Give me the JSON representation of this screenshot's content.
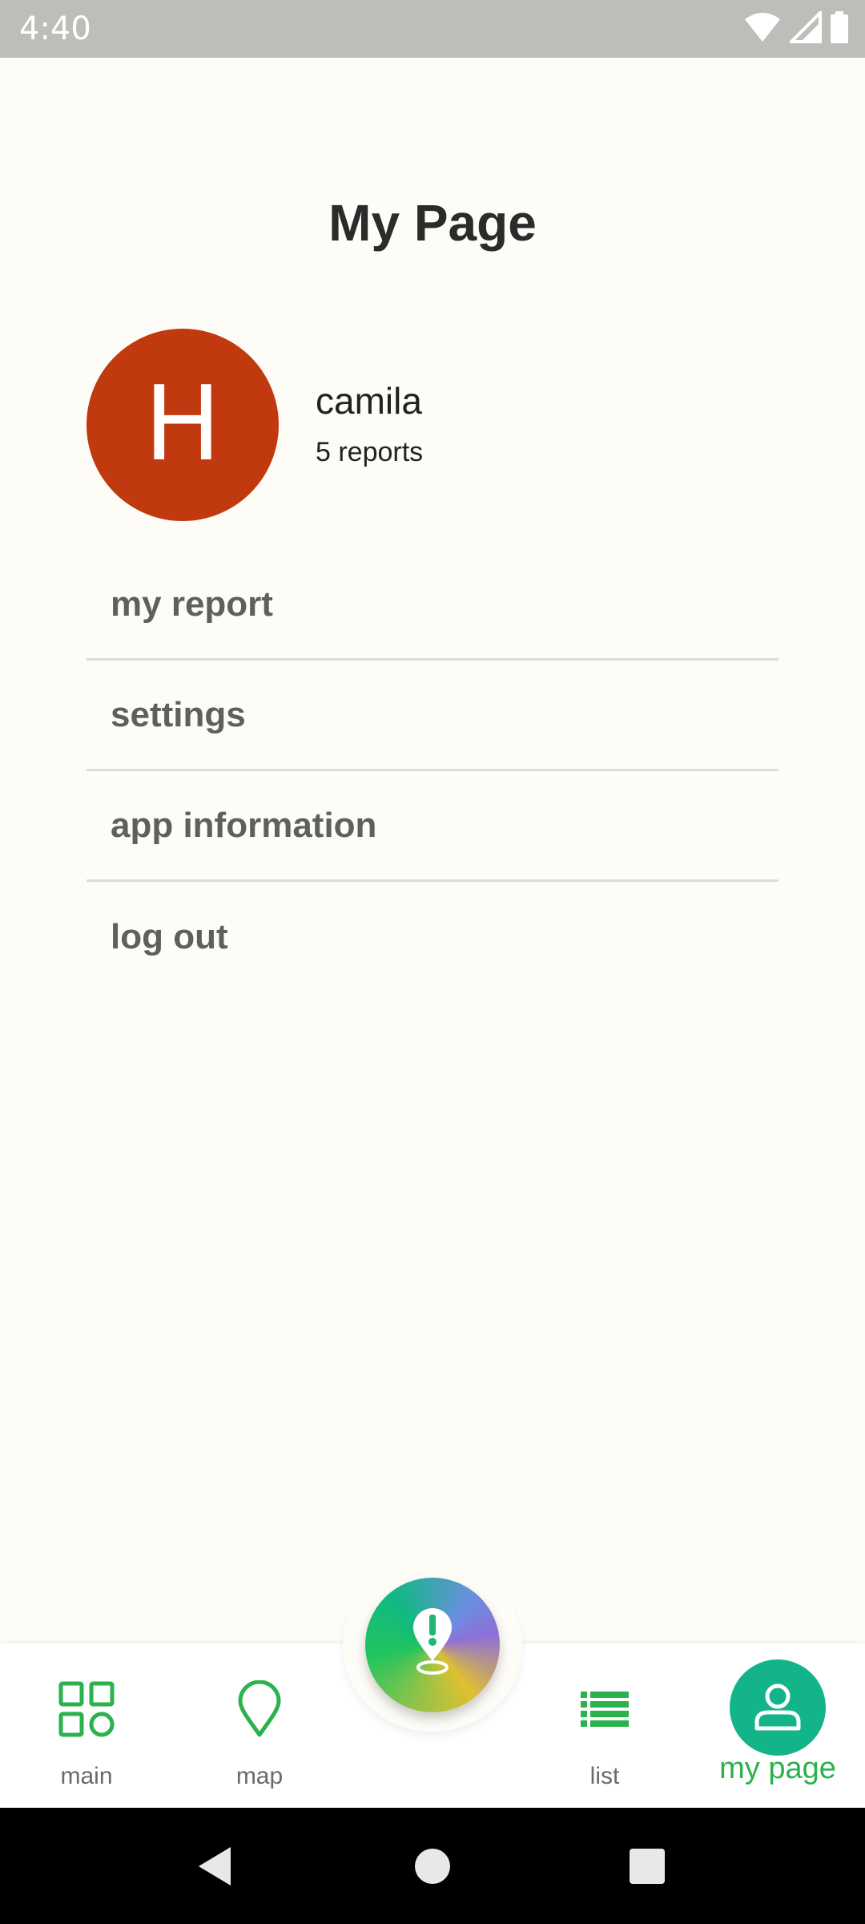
{
  "status_bar": {
    "time": "4:40",
    "icons": [
      "wifi-icon",
      "cellular-signal-icon",
      "battery-icon"
    ]
  },
  "page": {
    "title": "My Page"
  },
  "profile": {
    "avatar_letter": "H",
    "avatar_color": "#c0390f",
    "name": "camila",
    "reports": "5 reports"
  },
  "menu": {
    "items": [
      {
        "label": "my report"
      },
      {
        "label": "settings"
      },
      {
        "label": "app information"
      },
      {
        "label": "log out"
      }
    ]
  },
  "bottom_nav": {
    "items": [
      {
        "label": "main",
        "icon": "grid-icon"
      },
      {
        "label": "map",
        "icon": "map-pin-icon"
      },
      {
        "label": "list",
        "icon": "list-icon"
      },
      {
        "label": "my page",
        "icon": "person-icon",
        "active": true
      }
    ],
    "fab_icon": "report-alert-pin-icon",
    "accent_color": "#2bb24c",
    "active_circle_color": "#13b48a"
  },
  "system_nav": {
    "buttons": [
      "back-icon",
      "home-icon",
      "recents-icon"
    ]
  }
}
